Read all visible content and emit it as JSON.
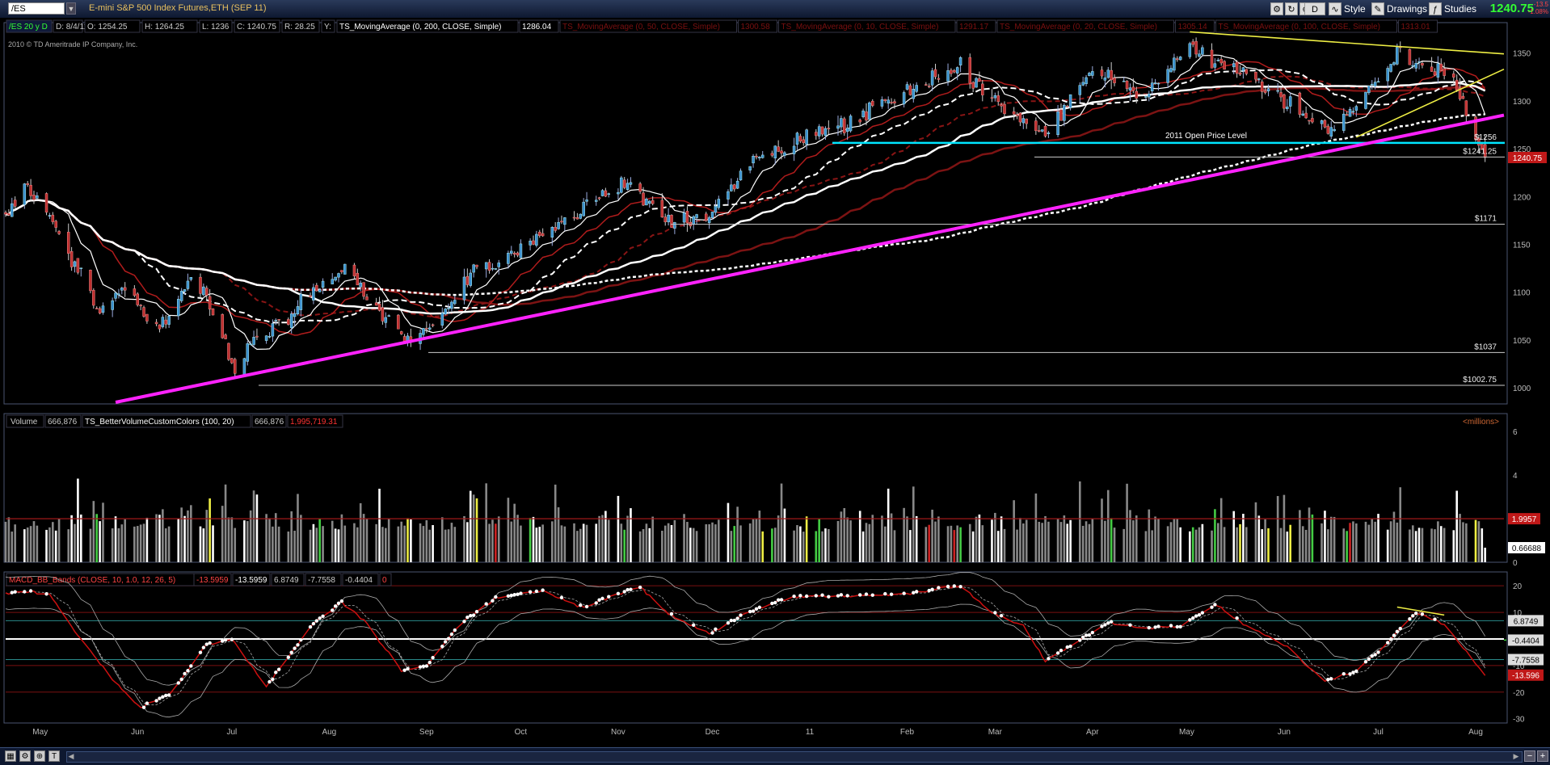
{
  "app": {
    "symbol": "/ES",
    "title": "E-mini S&P 500 Index Futures,ETH (SEP 11)",
    "last_price": "1240.75",
    "change_1": "-13.5",
    "change_2": "-1.08%",
    "buttons": {
      "d": "D",
      "style": "Style",
      "drawings": "Drawings",
      "studies": "Studies"
    }
  },
  "price_header": {
    "chart_label": "/ES 20 y D",
    "date": "D: 8/4/11",
    "open": "O: 1254.25",
    "high": "H: 1264.25",
    "low": "L: 1236",
    "close": "C: 1240.75",
    "range": "R: 28.25",
    "y": "Y:",
    "studies": [
      {
        "name": "TS_MovingAverage (0, 200, CLOSE, Simple)",
        "value": "1286.04"
      },
      {
        "name": "TS_MovingAverage (0, 50, CLOSE, Simple)",
        "value": "1300.58"
      },
      {
        "name": "TS_MovingAverage (0, 10, CLOSE, Simple)",
        "value": "1291.17"
      },
      {
        "name": "TS_MovingAverage (0, 20, CLOSE, Simple)",
        "value": "1305.14"
      },
      {
        "name": "TS_MovingAverage (0, 100, CLOSE, Simple)",
        "value": "1313.01"
      }
    ],
    "copyright": "2010 © TD Ameritrade IP Company, Inc."
  },
  "volume_header": {
    "label": "Volume",
    "value": "666,876",
    "study": "TS_BetterVolumeCustomColors (100, 20)",
    "study_value": "666,876",
    "avg_value": "1,995,719.31",
    "units": "<millions>"
  },
  "macd_header": {
    "label": "MACD_BB_Bands (CLOSE, 10, 1.0, 12, 26, 5)",
    "v1": "-13.5959",
    "v2": "-13.5959",
    "v3": "6.8749",
    "v4": "-7.7558",
    "v5": "-0.4404",
    "v6": "0"
  },
  "annotations": {
    "open_price_label": "2011 Open Price Level",
    "levels": [
      {
        "label": "$1256",
        "value": 1256,
        "color": "#00e5ff"
      },
      {
        "label": "$1241.25",
        "value": 1241.25,
        "color": "#cccccc"
      },
      {
        "label": "$1171",
        "value": 1171,
        "color": "#cccccc"
      },
      {
        "label": "$1037",
        "value": 1037,
        "color": "#cccccc"
      },
      {
        "label": "$1002.75",
        "value": 1002.75,
        "color": "#cccccc"
      }
    ]
  },
  "price_badge": "1240.75",
  "volume_badges": [
    "1.9957",
    "0.66688"
  ],
  "macd_badges": [
    "6.8749",
    "-0.4404",
    "-7.7558",
    "-13.596"
  ],
  "chart_data": [
    {
      "type": "candlestick",
      "title": "/ES 20 y D",
      "ylim": [
        985,
        1380
      ],
      "y_ticks": [
        1000,
        1050,
        1100,
        1150,
        1200,
        1250,
        1300,
        1350
      ],
      "x_ticks": [
        "May",
        "Jun",
        "Jul",
        "Aug",
        "Sep",
        "Oct",
        "Nov",
        "Dec",
        "11",
        "Feb",
        "Mar",
        "Apr",
        "May",
        "Jun",
        "Jul",
        "Aug"
      ],
      "close_path": {
        "dates": [
          "2010-04-20",
          "2010-04-26",
          "2010-05-06",
          "2010-05-20",
          "2010-05-27",
          "2010-06-07",
          "2010-06-18",
          "2010-06-22",
          "2010-07-02",
          "2010-07-07",
          "2010-07-20",
          "2010-07-28",
          "2010-08-06",
          "2010-08-16",
          "2010-08-25",
          "2010-08-31",
          "2010-09-15",
          "2010-10-01",
          "2010-10-15",
          "2010-11-04",
          "2010-11-16",
          "2010-11-30",
          "2010-12-15",
          "2011-01-03",
          "2011-01-20",
          "2011-02-10",
          "2011-02-18",
          "2011-03-01",
          "2011-03-16",
          "2011-04-01",
          "2011-04-18",
          "2011-05-02",
          "2011-05-20",
          "2011-06-15",
          "2011-07-01",
          "2011-07-07",
          "2011-07-20",
          "2011-07-25",
          "2011-08-04"
        ],
        "values": [
          1180,
          1210,
          1165,
          1075,
          1110,
          1060,
          1115,
          1100,
          1020,
          1050,
          1075,
          1105,
          1125,
          1085,
          1050,
          1058,
          1120,
          1145,
          1175,
          1215,
          1175,
          1180,
          1240,
          1265,
          1290,
          1325,
          1335,
          1300,
          1265,
          1330,
          1305,
          1355,
          1330,
          1265,
          1325,
          1350,
          1330,
          1315,
          1240
        ]
      },
      "series": [
        {
          "name": "TS_MovingAverage (0, 10, CLOSE, Simple)",
          "values_last": 1291.17
        },
        {
          "name": "TS_MovingAverage (0, 20, CLOSE, Simple)",
          "values_last": 1305.14
        },
        {
          "name": "TS_MovingAverage (0, 50, CLOSE, Simple)",
          "values_last": 1300.58
        },
        {
          "name": "TS_MovingAverage (0, 100, CLOSE, Simple)",
          "values_last": 1313.01
        },
        {
          "name": "TS_MovingAverage (0, 200, CLOSE, Simple)",
          "values_last": 1286.04
        }
      ],
      "trendlines": [
        {
          "color": "#ff22ff",
          "from": {
            "date": "2010-05-25",
            "value": 985
          },
          "to": {
            "date": "2011-08-10",
            "value": 1285
          }
        },
        {
          "color": "#eeee44",
          "from": {
            "date": "2011-05-02",
            "value": 1372
          },
          "to": {
            "date": "2011-08-10",
            "value": 1349
          }
        },
        {
          "color": "#eeee44",
          "from": {
            "date": "2011-06-24",
            "value": 1262
          },
          "to": {
            "date": "2011-08-10",
            "value": 1333
          }
        }
      ]
    },
    {
      "type": "bar",
      "title": "Volume",
      "ylim": [
        0,
        6
      ],
      "y_ticks": [
        0,
        2,
        4,
        6
      ],
      "average": 1.9957,
      "last": 0.66688
    },
    {
      "type": "line",
      "title": "MACD_BB_Bands (CLOSE, 10, 1.0, 12, 26, 5)",
      "ylim": [
        -31,
        24
      ],
      "y_ticks": [
        -30,
        -20,
        -10,
        0,
        10,
        20
      ],
      "reference_lines": [
        20,
        10,
        6.8749,
        -7.7558,
        -10,
        -20
      ],
      "macd_path": {
        "dates": [
          "2010-04-20",
          "2010-04-28",
          "2010-05-04",
          "2010-05-12",
          "2010-05-24",
          "2010-06-02",
          "2010-06-12",
          "2010-06-23",
          "2010-07-01",
          "2010-07-12",
          "2010-07-20",
          "2010-07-28",
          "2010-08-05",
          "2010-08-13",
          "2010-08-24",
          "2010-09-01",
          "2010-09-12",
          "2010-09-24",
          "2010-10-08",
          "2010-10-20",
          "2010-11-01",
          "2010-11-08",
          "2010-11-16",
          "2010-11-30",
          "2010-12-12",
          "2010-12-26",
          "2011-01-15",
          "2011-02-01",
          "2011-02-18",
          "2011-02-28",
          "2011-03-10",
          "2011-03-17",
          "2011-03-27",
          "2011-04-06",
          "2011-04-18",
          "2011-04-30",
          "2011-05-10",
          "2011-05-20",
          "2011-06-02",
          "2011-06-14",
          "2011-06-24",
          "2011-07-05",
          "2011-07-13",
          "2011-07-22",
          "2011-08-04"
        ],
        "values": [
          17,
          18,
          17,
          3,
          -15,
          -26,
          -20,
          -2,
          0,
          -18,
          -5,
          7,
          14,
          6,
          -12,
          -10,
          6,
          16,
          18,
          12,
          17,
          20,
          10,
          2,
          10,
          16,
          16,
          17,
          20,
          10,
          5,
          -8,
          -1,
          6,
          4,
          5,
          13,
          5,
          -3,
          -16,
          -12,
          0,
          10,
          6,
          -13.6
        ]
      }
    }
  ]
}
